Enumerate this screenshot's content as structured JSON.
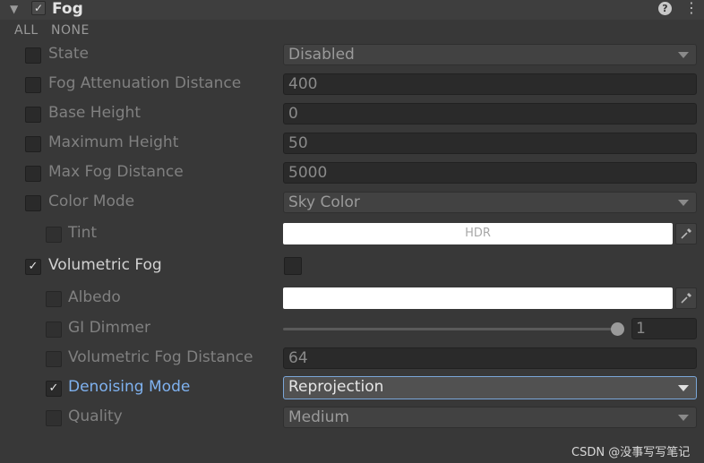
{
  "header": {
    "title": "Fog",
    "enabled": true,
    "help_icon": "help-icon",
    "menu_icon": "kebab-menu-icon"
  },
  "toggles": {
    "all": "ALL",
    "none": "NONE"
  },
  "rows": {
    "state": {
      "label": "State",
      "value": "Disabled"
    },
    "fog_attenuation_distance": {
      "label": "Fog Attenuation Distance",
      "value": "400"
    },
    "base_height": {
      "label": "Base Height",
      "value": "0"
    },
    "maximum_height": {
      "label": "Maximum Height",
      "value": "50"
    },
    "max_fog_distance": {
      "label": "Max Fog Distance",
      "value": "5000"
    },
    "color_mode": {
      "label": "Color Mode",
      "value": "Sky Color"
    },
    "tint": {
      "label": "Tint",
      "value": "#ffffff",
      "hdr": "HDR"
    },
    "volumetric_fog": {
      "label": "Volumetric Fog",
      "override": true,
      "value": false
    },
    "albedo": {
      "label": "Albedo",
      "value": "#ffffff"
    },
    "gi_dimmer": {
      "label": "GI Dimmer",
      "value": "1",
      "slider_fraction": 1.0
    },
    "volumetric_fog_distance": {
      "label": "Volumetric Fog Distance",
      "value": "64"
    },
    "denoising_mode": {
      "label": "Denoising Mode",
      "override": true,
      "value": "Reprojection"
    },
    "quality": {
      "label": "Quality",
      "value": "Medium"
    }
  },
  "colors": {
    "background": "#383838",
    "accent_label": "#7fb2f0",
    "active_border": "#7ba6d8"
  },
  "watermark": "CSDN @没事写写笔记"
}
